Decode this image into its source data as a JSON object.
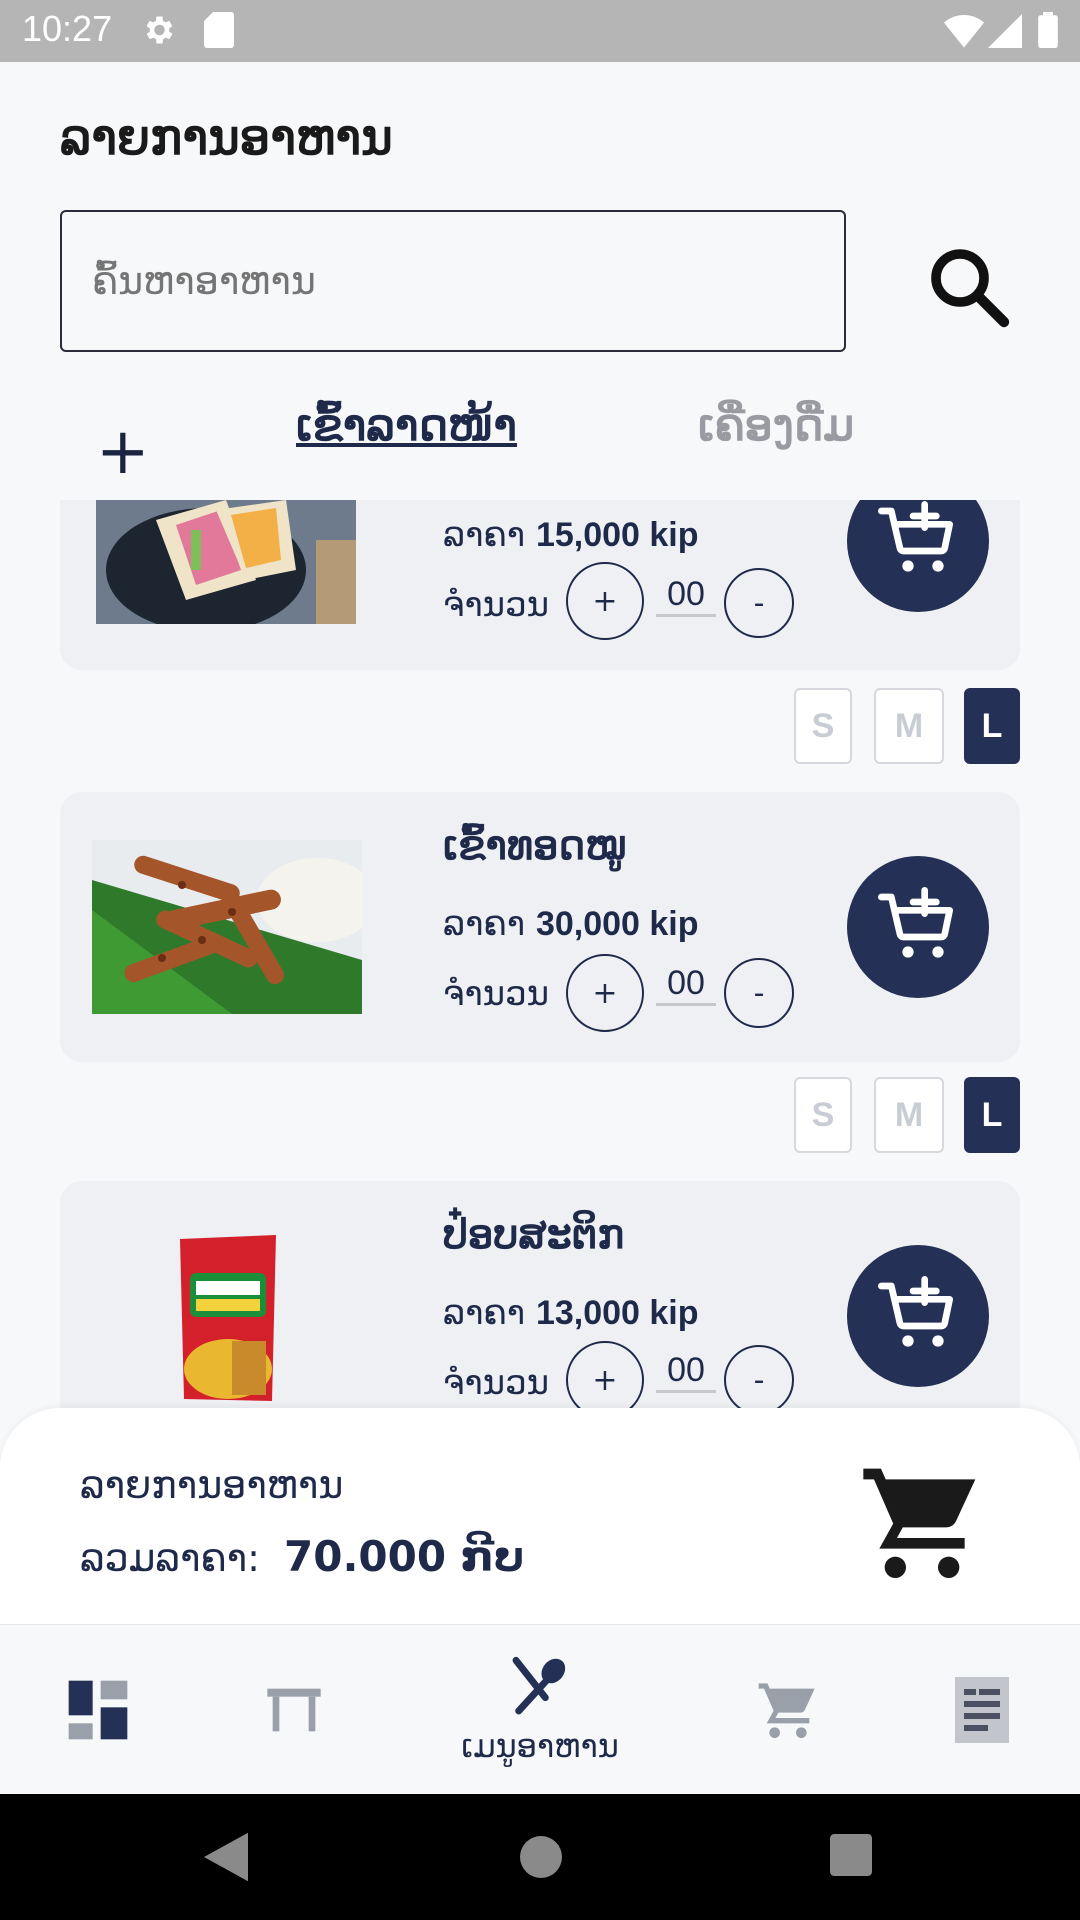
{
  "status_bar": {
    "time": "10:27"
  },
  "page_title": "ລາຍການອາຫານ",
  "search": {
    "placeholder": "ຄົ້ນຫາອາຫານ"
  },
  "tabs": [
    {
      "label": "ເຂົ້າລາດໜ້າ",
      "active": true
    },
    {
      "label": "ເຄື່ອງດື່ມ",
      "active": false
    }
  ],
  "labels": {
    "price_prefix": "ລາຄາ",
    "qty_label": "ຈຳນວນ",
    "plus": "+",
    "minus": "-"
  },
  "items": [
    {
      "name": "",
      "price": "15,000 kip",
      "qty": "00",
      "image_icon": "sandwich-photo"
    },
    {
      "name": "ເຂົ້າທອດໝູ",
      "price": "30,000 kip",
      "qty": "00",
      "image_icon": "fried-pork-photo"
    },
    {
      "name": "ປ໋ອບສະຕິກ",
      "price": "13,000 kip",
      "qty": "00",
      "image_icon": "pomsticks-photo"
    }
  ],
  "sizes": [
    "S",
    "M",
    "L"
  ],
  "selected_size": "L",
  "summary": {
    "label": "ລາຍການອາຫານ",
    "total_label": "ລວມລາຄາ:",
    "total_value": "70.000 ກີບ"
  },
  "bottom_nav": [
    {
      "icon": "dashboard-icon",
      "label": ""
    },
    {
      "icon": "table-icon",
      "label": ""
    },
    {
      "icon": "fork-spoon-icon",
      "label": "ເມນູອາຫານ",
      "active": true
    },
    {
      "icon": "cart-icon",
      "label": ""
    },
    {
      "icon": "receipt-icon",
      "label": ""
    }
  ],
  "colors": {
    "primary": "#243055",
    "card_bg": "#eef0f4",
    "page_bg": "#f7f8fa"
  }
}
